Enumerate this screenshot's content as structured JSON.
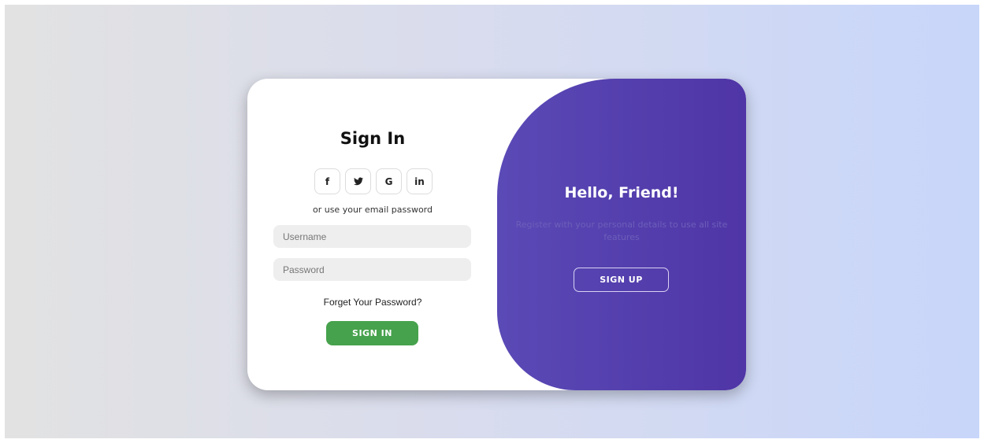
{
  "signin": {
    "title": "Sign In",
    "social_buttons": [
      {
        "label": "f",
        "icon": "facebook-icon"
      },
      {
        "label": "y",
        "icon": "twitter-icon"
      },
      {
        "label": "G",
        "icon": "google-icon"
      },
      {
        "label": "in",
        "icon": "linkedin-icon"
      }
    ],
    "alt_text": "or use your email password",
    "username_placeholder": "Username",
    "password_placeholder": "Password",
    "forgot_label": "Forget Your Password?",
    "button_label": "SIGN IN"
  },
  "panel": {
    "title": "Hello, Friend!",
    "text": "Register with your personal details to use all site features",
    "button_label": "SIGN UP"
  },
  "colors": {
    "accent_green": "#46a24c",
    "panel_purple": "#5a4ab6"
  }
}
